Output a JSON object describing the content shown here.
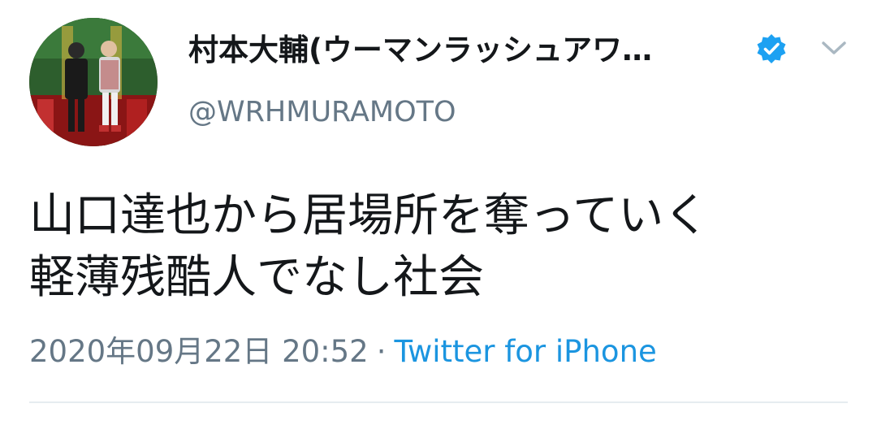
{
  "user": {
    "display_name": "村本大輔(ウーマンラッシュアワ…",
    "handle": "@WRHMURAMOTO",
    "avatar_icon": "profile-photo",
    "verified_icon": "verified-badge-icon",
    "verified_color": "#1da1f2"
  },
  "menu": {
    "icon": "chevron-down-icon",
    "color": "#aab8c2"
  },
  "tweet": {
    "lines": [
      "山口達也から居場所を奪っていく",
      "軽薄残酷人でなし社会"
    ],
    "timestamp": "2020年09月22日 20:52",
    "separator": "·",
    "source": "Twitter for iPhone"
  },
  "colors": {
    "text": "#14171a",
    "secondary": "#657786",
    "link": "#1b95e0"
  }
}
